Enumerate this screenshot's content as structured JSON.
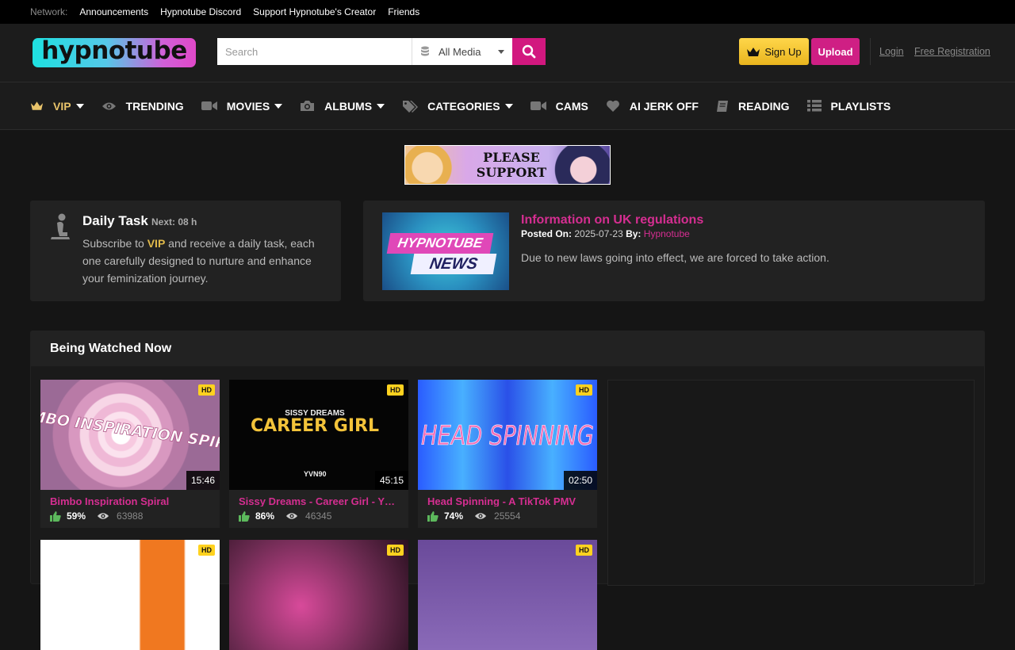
{
  "network": {
    "label": "Network:",
    "links": [
      "Announcements",
      "Hypnotube Discord",
      "Support Hypnotube's Creator",
      "Friends"
    ]
  },
  "header": {
    "logo_text": "hypnotube",
    "search_placeholder": "Search",
    "media_filter": "All Media",
    "signup_label": "Sign Up",
    "upload_label": "Upload",
    "login_label": "Login",
    "free_registration_label": "Free Registration"
  },
  "nav": {
    "items": [
      {
        "label": "VIP",
        "icon": "crown-icon",
        "dropdown": true
      },
      {
        "label": "TRENDING",
        "icon": "eye-icon",
        "dropdown": false
      },
      {
        "label": "MOVIES",
        "icon": "video-camera-icon",
        "dropdown": true
      },
      {
        "label": "ALBUMS",
        "icon": "camera-icon",
        "dropdown": true
      },
      {
        "label": "CATEGORIES",
        "icon": "tags-icon",
        "dropdown": true
      },
      {
        "label": "CAMS",
        "icon": "video-camera-icon",
        "dropdown": false
      },
      {
        "label": "AI JERK OFF",
        "icon": "heart-icon",
        "dropdown": false
      },
      {
        "label": "READING",
        "icon": "book-icon",
        "dropdown": false
      },
      {
        "label": "PLAYLISTS",
        "icon": "list-icon",
        "dropdown": false
      }
    ]
  },
  "banner": {
    "text_line1": "PLEASE",
    "text_line2": "SUPPORT"
  },
  "daily_task": {
    "title": "Daily Task",
    "next": "Next: 08 h",
    "desc_before": "Subscribe to ",
    "desc_vip": "VIP",
    "desc_after": " and receive a daily task, each one carefully designed to nurture and enhance your feminization journey."
  },
  "news": {
    "thumb_line1": "HYPNOTUBE",
    "thumb_line2": "NEWS",
    "title": "Information on UK regulations",
    "posted_label": "Posted On:",
    "posted_date": "2025-07-23",
    "by_label": "By:",
    "author": "Hypnotube",
    "text": "Due to new laws going into effect, we are forced to take action."
  },
  "being_watched": {
    "heading": "Being Watched Now",
    "videos": [
      {
        "title": "Bimbo Inspiration Spiral",
        "thumb_text": "BIMBO INSPIRATION SPIRAL",
        "badge": "HD",
        "duration": "15:46",
        "rating": "59%",
        "views": "63988"
      },
      {
        "title": "Sissy Dreams - Career Girl - YVN...",
        "thumb_text_top": "SISSY DREAMS",
        "thumb_text_main": "CAREER GIRL",
        "thumb_text_bottom": "YVN90",
        "badge": "HD",
        "duration": "45:15",
        "rating": "86%",
        "views": "46345"
      },
      {
        "title": "Head Spinning - A TikTok PMV",
        "thumb_text": "HEAD SPINNING",
        "badge": "HD",
        "duration": "02:50",
        "rating": "74%",
        "views": "25554"
      },
      {
        "badge": "HD"
      },
      {
        "badge": "HD"
      },
      {
        "badge": "HD"
      }
    ]
  }
}
